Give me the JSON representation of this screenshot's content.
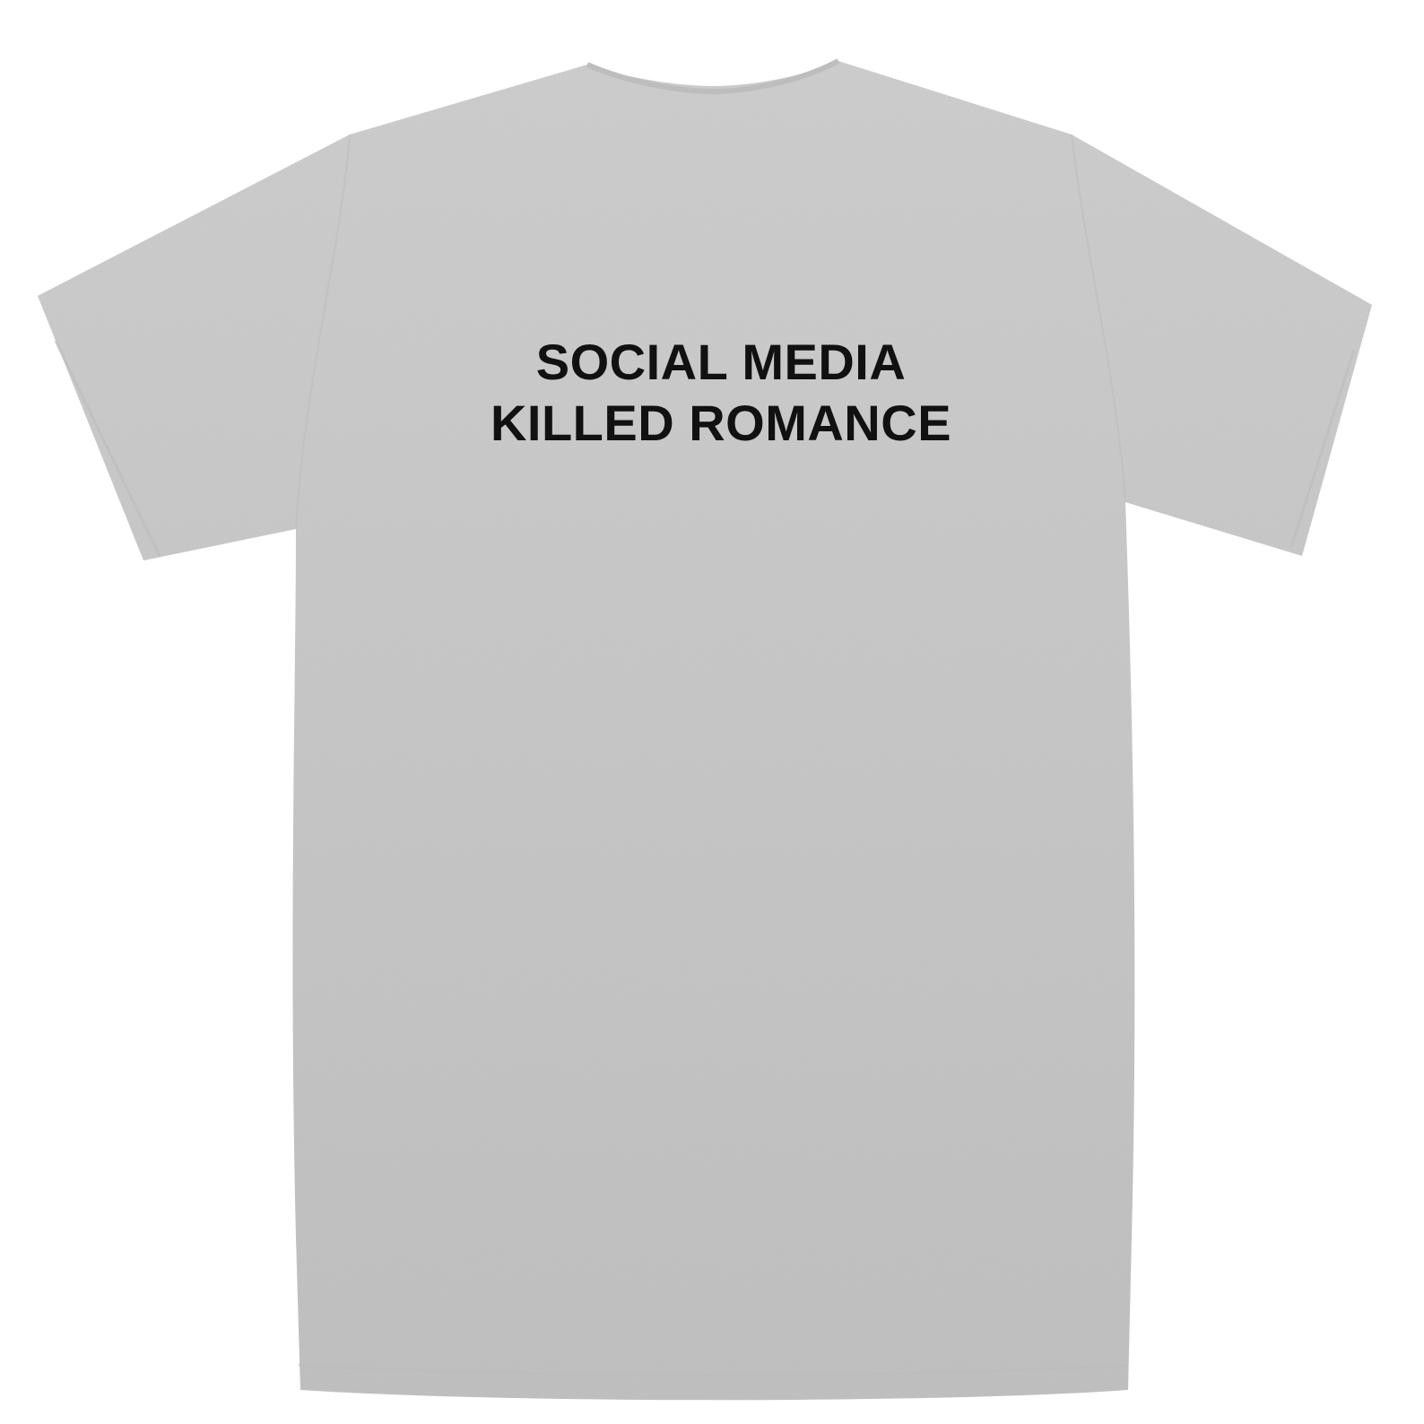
{
  "product": {
    "type": "t-shirt",
    "view": "back",
    "fabric_color": "#c9c9c9",
    "print_color": "#111111",
    "print_lines": [
      "SOCIAL MEDIA",
      "KILLED ROMANCE"
    ]
  }
}
